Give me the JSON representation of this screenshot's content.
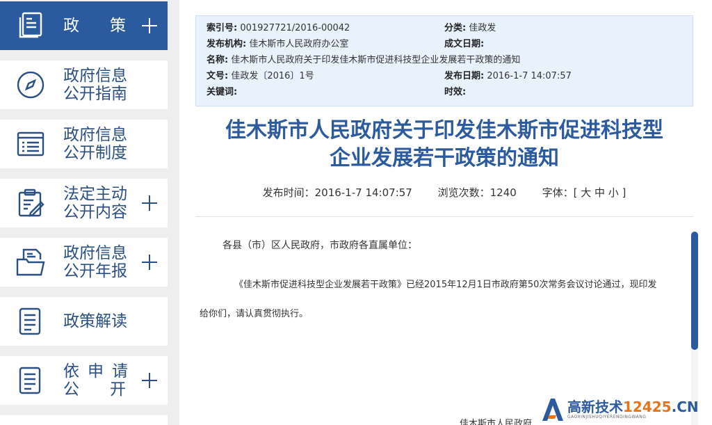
{
  "sidebar": {
    "items": [
      {
        "label1": "政",
        "label2": "策",
        "icon": "document-stack-icon",
        "active": true
      },
      {
        "label1": "政府信息",
        "label2": "公开指南",
        "icon": "compass-icon"
      },
      {
        "label1": "政府信息",
        "label2": "公开制度",
        "icon": "list-icon"
      },
      {
        "label1": "法定主动",
        "label2": "公开内容",
        "icon": "clipboard-edit-icon"
      },
      {
        "label1": "政府信息",
        "label2": "公开年报",
        "icon": "folder-document-icon"
      },
      {
        "label1": "政策解读",
        "icon": "document-lines-icon"
      },
      {
        "label1": "依申请",
        "label2": "公开",
        "icon": "document-lines-icon"
      }
    ]
  },
  "meta": {
    "index_label": "索引号:",
    "index_value": "001927721/2016-00042",
    "category_label": "分类:",
    "category_value": "佳政发",
    "publisher_label": "发布机构:",
    "publisher_value": "佳木斯市人民政府办公室",
    "created_label": "成文日期:",
    "created_value": "",
    "name_label": "名称:",
    "name_value": "佳木斯市人民政府关于印发佳木斯市促进科技型企业发展若干政策的通知",
    "docno_label": "文号:",
    "docno_value": "佳政发〔2016〕1号",
    "pubdate_label": "发布日期:",
    "pubdate_value": "2016-1-7 14:07:57",
    "keywords_label": "关键词:",
    "keywords_value": "",
    "validity_label": "时效:",
    "validity_value": ""
  },
  "article": {
    "title_line1": "佳木斯市人民政府关于印发佳木斯市促进科技型",
    "title_line2": "企业发展若干政策的通知",
    "publish_time": "发布时间：2016-1-7 14:07:57",
    "views": "浏览次数：1240",
    "font_size": "字体：[ 大 中 小 ]",
    "salutation": "各县（市）区人民政府，市政府各直属单位：",
    "para1": "《佳木斯市促进科技型企业发展若干政策》已经2015年12月1日市政府第50次常务会议讨论通过，现印发",
    "para2": "给你们，请认真贯彻执行。",
    "signature": "佳木斯市人民政府"
  },
  "watermark": {
    "main": "高新技术",
    "domain": "12425",
    "tld": ".CN",
    "sub": "GAOXINJISHUQIYERENDINGWANG"
  },
  "colors": {
    "accent": "#2b5b9e",
    "meta_bg": "#e8f2fc"
  }
}
